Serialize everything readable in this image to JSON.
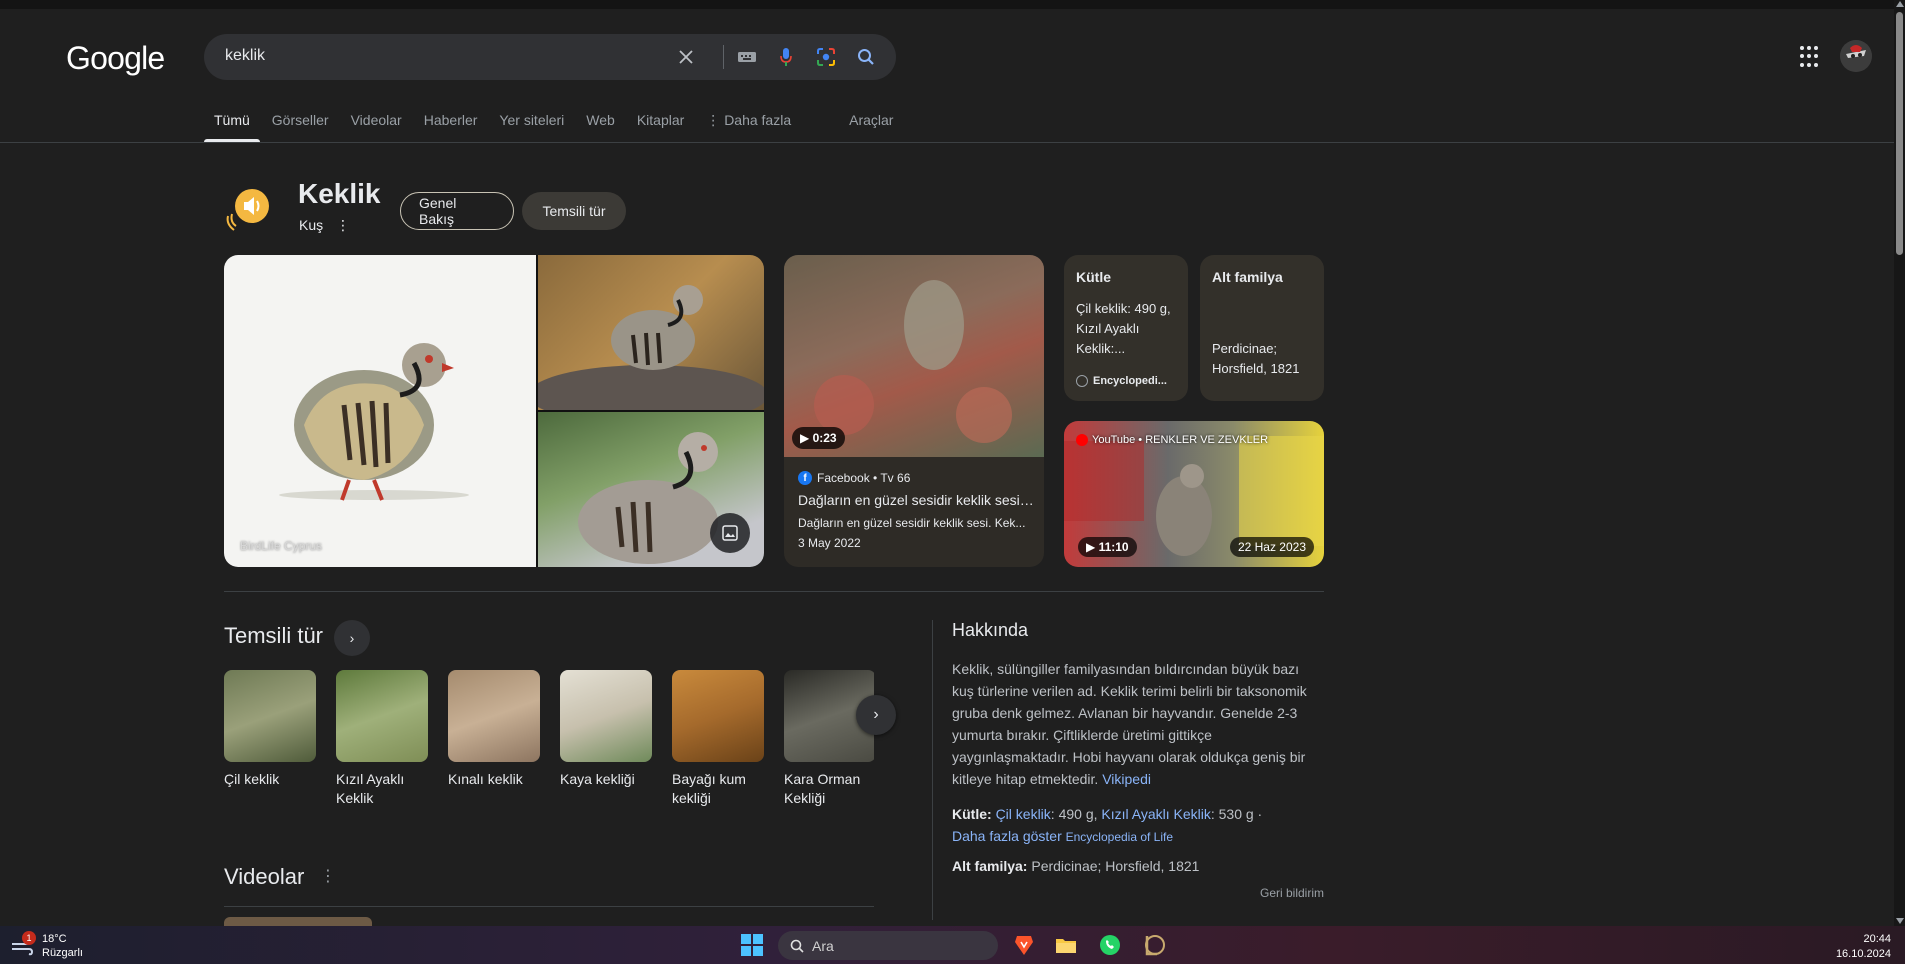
{
  "header": {
    "logo": "Google",
    "query": "keklik"
  },
  "tabs": [
    "Tümü",
    "Görseller",
    "Videolar",
    "Haberler",
    "Yer siteleri",
    "Web",
    "Kitaplar",
    "Daha fazla",
    "Araçlar"
  ],
  "entity": {
    "title": "Keklik",
    "subtitle": "Kuş",
    "pill_overview": "Genel Bakış",
    "pill_species": "Temsili tür"
  },
  "images": {
    "main_caption": "BirdLife Cyprus"
  },
  "video_card": {
    "duration": "0:23",
    "source": "Facebook • Tv 66",
    "title": "Dağların en güzel sesidir keklik sesi....",
    "desc": "Dağların en güzel sesidir keklik sesi. Kek...",
    "date": "3 May 2022"
  },
  "facts": {
    "mass_label": "Kütle",
    "mass_value": "Çil keklik: 490 g, Kızıl Ayaklı Keklik:...",
    "mass_source": "Encyclopedi...",
    "subfamily_label": "Alt familya",
    "subfamily_value": "Perdicinae; Horsfield, 1821"
  },
  "yt_card": {
    "source": "YouTube • RENKLER VE ZEVKLER",
    "duration": "11:10",
    "date": "22 Haz 2023"
  },
  "species_section": {
    "title": "Temsili tür",
    "items": [
      {
        "name": "Çil keklik",
        "color": "#6f7a55"
      },
      {
        "name": "Kızıl Ayaklı Keklik",
        "color": "#7f8e56"
      },
      {
        "name": "Kınalı keklik",
        "color": "#a58b6e"
      },
      {
        "name": "Kaya kekliği",
        "color": "#c7c0ad"
      },
      {
        "name": "Bayağı kum kekliği",
        "color": "#a56a2c"
      },
      {
        "name": "Kara Orman Kekliği",
        "color": "#4a4a42"
      }
    ]
  },
  "videos_section": {
    "title": "Videolar"
  },
  "about": {
    "title": "Hakkında",
    "text": "Keklik, sülüngiller familyasından bıldırcından büyük bazı kuş türlerine verilen ad. Keklik terimi belirli bir taksonomik gruba denk gelmez. Avlanan bir hayvandır. Genelde 2-3 yumurta bırakır. Çiftliklerde üretimi gittikçe yaygınlaşmaktadır. Hobi hayvanı olarak oldukça geniş bir kitleye hitap etmektedir.",
    "wiki_link": "Vikipedi",
    "mass_label": "Kütle:",
    "mass_link1": "Çil keklik",
    "mass_val1": ": 490 g,",
    "mass_link2": "Kızıl Ayaklı Keklik",
    "mass_val2": ": 530 g ·",
    "more_link": "Daha fazla göster",
    "mass_source": "Encyclopedia of Life",
    "subfamily_label": "Alt familya:",
    "subfamily_value": "Perdicinae; Horsfield, 1821",
    "feedback": "Geri bildirim"
  },
  "taskbar": {
    "temp": "18°C",
    "weather": "Rüzgarlı",
    "badge": "1",
    "search": "Ara",
    "time": "20:44",
    "date": "16.10.2024"
  },
  "colors": {
    "background": "#1f1f1f",
    "link": "#8ab4f8",
    "accent_icon": "#f4b841"
  }
}
